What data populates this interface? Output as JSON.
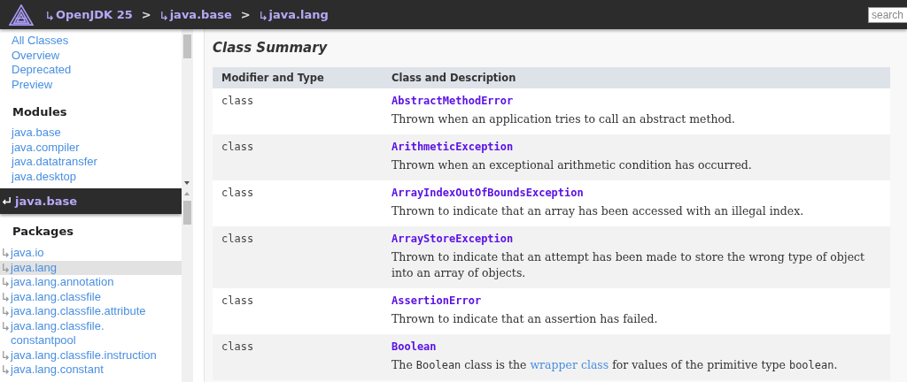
{
  "topbar": {
    "breadcrumbs": [
      {
        "label": "OpenJDK 25"
      },
      {
        "label": "java.base"
      },
      {
        "label": "java.lang"
      }
    ],
    "separators": [
      ">",
      ">"
    ],
    "search": {
      "placeholder": "search"
    }
  },
  "sidebar": {
    "nav": [
      {
        "label": "All Classes"
      },
      {
        "label": "Overview"
      },
      {
        "label": "Deprecated"
      },
      {
        "label": "Preview"
      }
    ],
    "modules_heading": "Modules",
    "modules": [
      {
        "label": "java.base"
      },
      {
        "label": "java.compiler"
      },
      {
        "label": "java.datatransfer"
      },
      {
        "label": "java.desktop"
      }
    ],
    "current_module": "java.base",
    "packages_heading": "Packages",
    "packages": [
      {
        "label": "java.io",
        "selected": false
      },
      {
        "label": "java.lang",
        "selected": true
      },
      {
        "label": "java.lang.annotation",
        "selected": false
      },
      {
        "label": "java.lang.classfile",
        "selected": false
      },
      {
        "label": "java.lang.classfile.attribute",
        "selected": false
      },
      {
        "label": "java.lang.classfile.\nconstantpool",
        "selected": false
      },
      {
        "label": "java.lang.classfile.instruction",
        "selected": false
      },
      {
        "label": "java.lang.constant",
        "selected": false
      }
    ]
  },
  "main": {
    "title": "Class Summary",
    "table": {
      "columns": [
        "Modifier and Type",
        "Class and Description"
      ],
      "rows": [
        {
          "modifier": "class",
          "name": "AbstractMethodError",
          "description": [
            {
              "kind": "text",
              "text": "Thrown when an application tries to call an abstract method."
            }
          ]
        },
        {
          "modifier": "class",
          "name": "ArithmeticException",
          "description": [
            {
              "kind": "text",
              "text": "Thrown when an exceptional arithmetic condition has occurred."
            }
          ]
        },
        {
          "modifier": "class",
          "name": "ArrayIndexOutOfBoundsException",
          "description": [
            {
              "kind": "text",
              "text": "Thrown to indicate that an array has been accessed with an illegal index."
            }
          ]
        },
        {
          "modifier": "class",
          "name": "ArrayStoreException",
          "description": [
            {
              "kind": "text",
              "text": "Thrown to indicate that an attempt has been made to store the wrong type of object into an array of objects."
            }
          ]
        },
        {
          "modifier": "class",
          "name": "AssertionError",
          "description": [
            {
              "kind": "text",
              "text": "Thrown to indicate that an assertion has failed."
            }
          ]
        },
        {
          "modifier": "class",
          "name": "Boolean",
          "description": [
            {
              "kind": "text",
              "text": "The "
            },
            {
              "kind": "code",
              "text": "Boolean"
            },
            {
              "kind": "text",
              "text": " class is the "
            },
            {
              "kind": "link",
              "text": "wrapper class"
            },
            {
              "kind": "text",
              "text": " for values of the primitive type "
            },
            {
              "kind": "code",
              "text": "boolean"
            },
            {
              "kind": "text",
              "text": "."
            }
          ]
        }
      ]
    }
  }
}
